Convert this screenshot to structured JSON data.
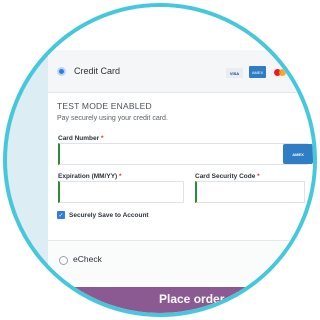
{
  "payment": {
    "credit_card": {
      "label": "Credit Card",
      "selected": true,
      "card_logos": [
        "visa",
        "american-express",
        "mastercard"
      ],
      "visa_text": "VISA",
      "amex_text": "AMEX"
    },
    "test_mode_text": "TEST MODE ENABLED",
    "secure_note": "Pay securely using your credit card.",
    "card_number": {
      "label": "Card Number",
      "required_mark": "*",
      "value": "",
      "detected_card": "american-express"
    },
    "expiration": {
      "label": "Expiration (MM/YY)",
      "required_mark": "*",
      "value": ""
    },
    "security_code": {
      "label": "Card Security Code",
      "required_mark": "*",
      "value": ""
    },
    "save_to_account": {
      "label": "Securely Save to Account",
      "checked": true
    },
    "echeck": {
      "label": "eCheck",
      "selected": false
    }
  },
  "place_order": {
    "label": "Place order"
  },
  "colors": {
    "frame_ring": "#45c8dc",
    "accent": "#2f7de1",
    "field_focus": "#2f8a3a",
    "button_bg": "#8c5a93",
    "required": "#c0392b"
  }
}
